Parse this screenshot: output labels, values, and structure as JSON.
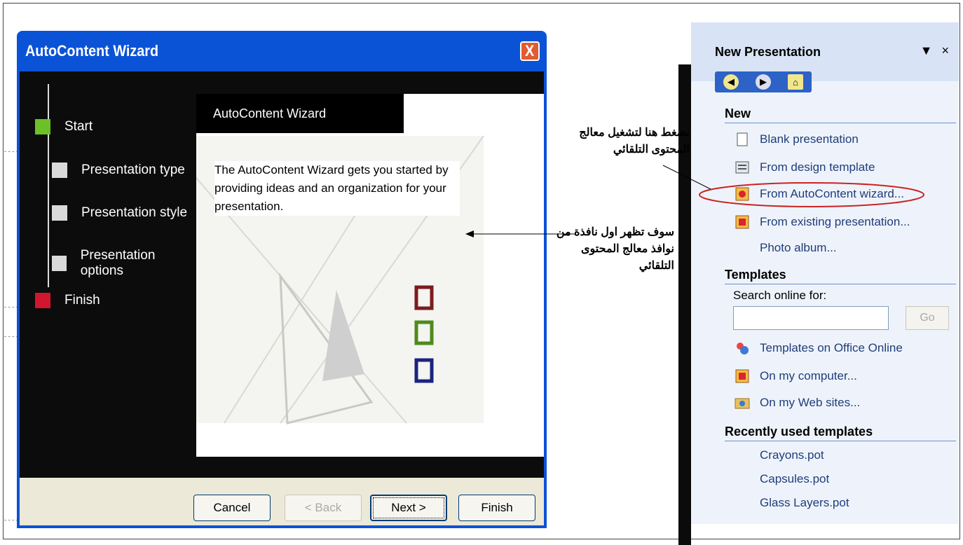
{
  "wizard": {
    "title": "AutoContent Wizard",
    "close_glyph": "X",
    "steps": [
      {
        "label": "Start",
        "color": "#6cc028"
      },
      {
        "label": "Presentation type",
        "color": "#d9d9d9"
      },
      {
        "label": "Presentation style",
        "color": "#d9d9d9"
      },
      {
        "label": "Presentation options",
        "color": "#d9d9d9"
      },
      {
        "label": "Finish",
        "color": "#d2162e"
      }
    ],
    "banner_title": "AutoContent Wizard",
    "description": "The AutoContent Wizard gets you started by providing ideas and an organization for your presentation.",
    "buttons": {
      "cancel": "Cancel",
      "back": "< Back",
      "next": "Next >",
      "finish": "Finish"
    }
  },
  "task_pane": {
    "title": "New Presentation",
    "dropdown_glyph": "▼",
    "close_glyph": "×",
    "nav": {
      "back_icon": "back-arrow-icon",
      "forward_icon": "forward-arrow-icon",
      "home_icon": "home-icon"
    },
    "new_section": {
      "heading": "New",
      "items": [
        "Blank presentation",
        "From design template",
        "From AutoContent wizard...",
        "From existing presentation...",
        "Photo album..."
      ]
    },
    "templates_section": {
      "heading": "Templates",
      "search_label": "Search online for:",
      "search_value": "",
      "go_label": "Go",
      "items": [
        "Templates on Office Online",
        "On my computer...",
        "On my Web sites..."
      ]
    },
    "recent_section": {
      "heading": "Recently used templates",
      "items": [
        "Crayons.pot",
        "Capsules.pot",
        "Glass Layers.pot"
      ]
    }
  },
  "annotations": {
    "top_note": "نضغط هنا لتشغيل معالج المحتوى التلقائي",
    "middle_note": "سوف تظهر اول نافذة من نوافذ معالج المحتوى التلقائي"
  },
  "colors": {
    "title_bar": "#0a53d6",
    "close_button": "#e25b32",
    "highlight_ellipse": "#cc2222",
    "decor_red": "#7a1d1d",
    "decor_green": "#4e8a1c",
    "decor_blue": "#1a237e"
  }
}
